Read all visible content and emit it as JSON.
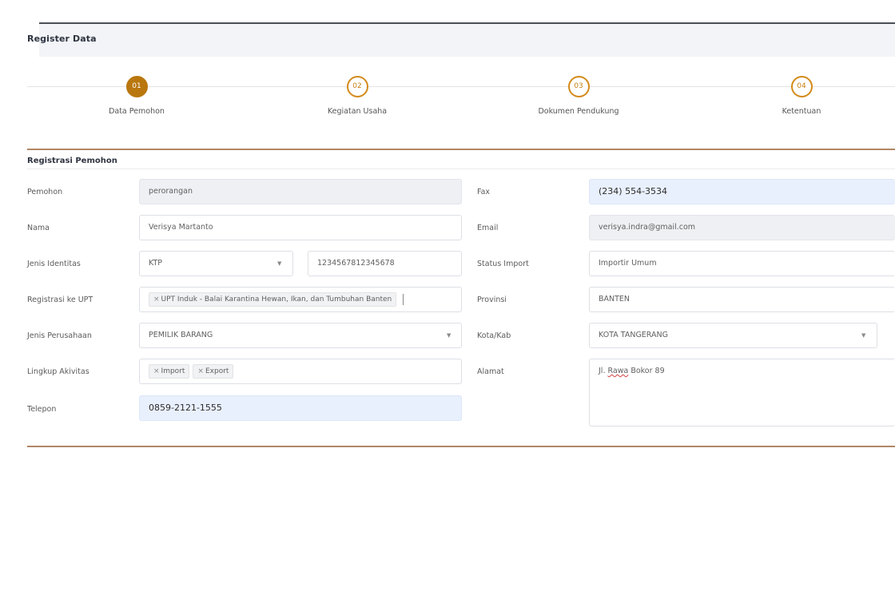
{
  "header": {
    "title": "Register Data"
  },
  "steps": [
    {
      "number": "01",
      "label": "Data Pemohon",
      "active": true
    },
    {
      "number": "02",
      "label": "Kegiatan Usaha",
      "active": false
    },
    {
      "number": "03",
      "label": "Dokumen Pendukung",
      "active": false
    },
    {
      "number": "04",
      "label": "Ketentuan",
      "active": false
    }
  ],
  "section": {
    "title": "Registrasi Pemohon"
  },
  "form": {
    "left": {
      "pemohon": {
        "label": "Pemohon",
        "value": "perorangan"
      },
      "nama": {
        "label": "Nama",
        "value": "Verisya Martanto"
      },
      "jenis_identitas": {
        "label": "Jenis Identitas",
        "value": "KTP",
        "number": "1234567812345678"
      },
      "registrasi_upt": {
        "label": "Registrasi ke UPT",
        "tag": "UPT Induk - Balai Karantina Hewan, Ikan, dan Tumbuhan Banten"
      },
      "jenis_perusahaan": {
        "label": "Jenis Perusahaan",
        "value": "PEMILIK BARANG"
      },
      "lingkup_aktivitas": {
        "label": "Lingkup Akivitas",
        "tags": [
          "Import",
          "Export"
        ]
      },
      "telepon": {
        "label": "Telepon",
        "value": "0859-2121-1555"
      }
    },
    "right": {
      "fax": {
        "label": "Fax",
        "value": "(234) 554-3534"
      },
      "email": {
        "label": "Email",
        "value": "verisya.indra@gmail.com"
      },
      "status_import": {
        "label": "Status Import",
        "value": "Importir Umum"
      },
      "provinsi": {
        "label": "Provinsi",
        "value": "BANTEN"
      },
      "kota_kab": {
        "label": "Kota/Kab",
        "value": "KOTA TANGERANG"
      },
      "alamat": {
        "label": "Alamat",
        "value_prefix": "Jl. ",
        "value_word": "Rawa",
        "value_suffix": " Bokor 89"
      }
    }
  },
  "icons": {
    "tag_remove": "×",
    "dropdown": "▼"
  },
  "colors": {
    "accent": "#b9770e",
    "input_highlight": "#e9f0fd"
  }
}
